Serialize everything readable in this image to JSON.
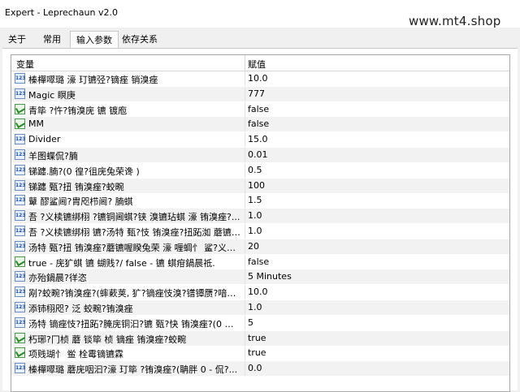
{
  "window": {
    "title": "Expert - Leprechaun v2.0"
  },
  "watermark": "www.mt4.shop",
  "tabs": [
    {
      "label": "关于"
    },
    {
      "label": "常用"
    },
    {
      "label": "输入参数"
    },
    {
      "label": "依存关系"
    }
  ],
  "active_tab": "输入参数",
  "grid": {
    "headers": {
      "variable": "变量",
      "value": "赋值"
    },
    "rows": [
      {
        "icon": "number-icon",
        "name": "榛樿噿璐 濠    玎镳弪?镝痤    销溴痤",
        "value": "10.0"
      },
      {
        "icon": "number-icon",
        "name": "Magic 瞑庚",
        "value": "777"
      },
      {
        "icon": "bool-icon",
        "name": "青筚   ?忤?铕溴庑 镳 镀庖",
        "value": "false"
      },
      {
        "icon": "bool-icon",
        "name": "MM",
        "value": "false"
      },
      {
        "icon": "number-icon",
        "name": "Divider",
        "value": "15.0"
      },
      {
        "icon": "number-icon",
        "name": "羊图蝶侃?腩",
        "value": "0.01"
      },
      {
        "icon": "number-icon",
        "name": "锑躔.腩?(0 徨?徂庑兔荣谗    )",
        "value": "0.5"
      },
      {
        "icon": "number-icon",
        "name": "锑躔 甄?扭 铕溴痤?蛟畹",
        "value": "100"
      },
      {
        "icon": "number-icon",
        "name": "鼙    醪鲨阃?胄咫栉阃? 腩蜞",
        "value": "1.5"
      },
      {
        "icon": "number-icon",
        "name": "吾     ?义椟镳绑栩 ?镳铜阃蜞?铗 溴镳玷蜞 濠     铕溴痤?...",
        "value": "1.0"
      },
      {
        "icon": "number-icon",
        "name": "吾    ?义椟镳绑栩 镳?汤特 甄?忮 铕溴痤?扭跖洳 蘑镳?...",
        "value": "1.0"
      },
      {
        "icon": "number-icon",
        "name": "汤特 甄?扭 铕溴痤?蘑镳喔睽兔荣     濠      喱蜩忄 鲨?义椟?...",
        "value": "20"
      },
      {
        "icon": "bool-icon",
        "name": "true - 庑犷蜞 镳 蝴贱?/ false -  镳 蜞疳鍋晨祗.",
        "value": "false"
      },
      {
        "icon": "number-icon",
        "name": "亦殆鍋晨?徉恣",
        "value": "5 Minutes"
      },
      {
        "icon": "number-icon",
        "name": "剐?蛟畹?铕溴痤?(蟀蔌荚, 犷?镝痤忮溴?镨镡赝?喑蝶镙?...",
        "value": "10.0"
      },
      {
        "icon": "number-icon",
        "name": "添铈栩咫?     泛 蛟畹?铕溴痤",
        "value": "1.0"
      },
      {
        "icon": "number-icon",
        "name": "汤特 镝痤忮?扭跖?腌庑铜汩?镳 甄?快 铕溴痤?(0 侃兔?...",
        "value": "5"
      },
      {
        "icon": "bool-icon",
        "name": "朽琊?冂桢 蘑 锬筚    桢 镝痤    铕溴痤?蛟畹",
        "value": "true"
      },
      {
        "icon": "bool-icon",
        "name": "项贱瑚忄     鲎 栓霉镝镳霖",
        "value": "true"
      },
      {
        "icon": "number-icon",
        "name": "榛樿噿璐 蘑庑咽汩?濠      玎筚    ?铕溴痤?(聃胖 0 - 侃?...",
        "value": "0.0"
      }
    ]
  }
}
